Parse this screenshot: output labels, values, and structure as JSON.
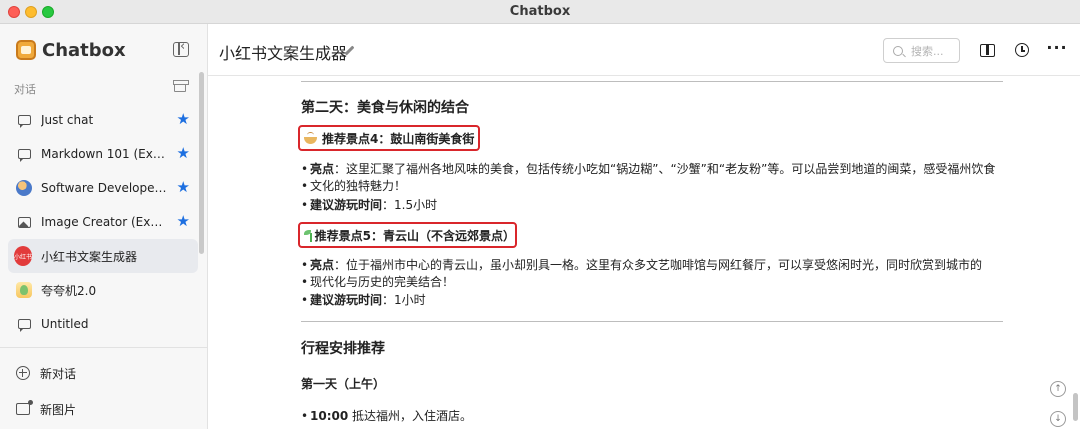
{
  "window": {
    "title": "Chatbox"
  },
  "sidebar": {
    "brand": "Chatbox",
    "section_label": "对话",
    "conversations": [
      {
        "label": "Just chat",
        "icon": "chat-bubble-icon",
        "starred": true,
        "active": false
      },
      {
        "label": "Markdown 101 (Example)",
        "icon": "chat-bubble-icon",
        "starred": true,
        "active": false
      },
      {
        "label": "Software Developer (Example)",
        "icon": "developer-avatar-icon",
        "starred": true,
        "active": false
      },
      {
        "label": "Image Creator (Example)",
        "icon": "image-icon",
        "starred": true,
        "active": false
      },
      {
        "label": "小红书文案生成器",
        "icon": "xiaohongshu-avatar-icon",
        "starred": false,
        "active": true
      },
      {
        "label": "夸夸机2.0",
        "icon": "kuakua-avatar-icon",
        "starred": false,
        "active": false
      },
      {
        "label": "Untitled",
        "icon": "chat-bubble-icon",
        "starred": false,
        "active": false
      }
    ],
    "avatar_badge_text": "小红书",
    "new_chat_label": "新对话",
    "new_image_label": "新图片"
  },
  "header": {
    "title": "小红书文案生成器",
    "search_placeholder": "搜索..."
  },
  "content": {
    "day2_heading": "第二天：美食与休闲的结合",
    "spot4": {
      "title": "推荐景点4：鼓山南街美食街",
      "highlight_label": "亮点",
      "highlight_text": "：这里汇聚了福州各地风味的美食，包括传统小吃如“锅边糊”、“沙蟹”和“老友粉”等。可以品尝到地道的闽菜，感受福州饮食",
      "highlight_text_2": "文化的独特魅力！",
      "time_label": "建议游玩时间",
      "time_value": "：1.5小时"
    },
    "spot5": {
      "title": "推荐景点5：青云山（不含远郊景点）",
      "highlight_label": "亮点",
      "highlight_text": "：位于福州市中心的青云山，虽小却别具一格。这里有众多文艺咖啡馆与网红餐厅，可以享受悠闲时光，同时欣赏到城市的",
      "highlight_text_2": "现代化与历史的完美结合！",
      "time_label": "建议游玩时间",
      "time_value": "：1小时"
    },
    "schedule_heading": "行程安排推荐",
    "day1_morning": "第一天（上午）",
    "item1_time": "10:00",
    "item1_text": " 抵达福州，入住酒店。"
  }
}
